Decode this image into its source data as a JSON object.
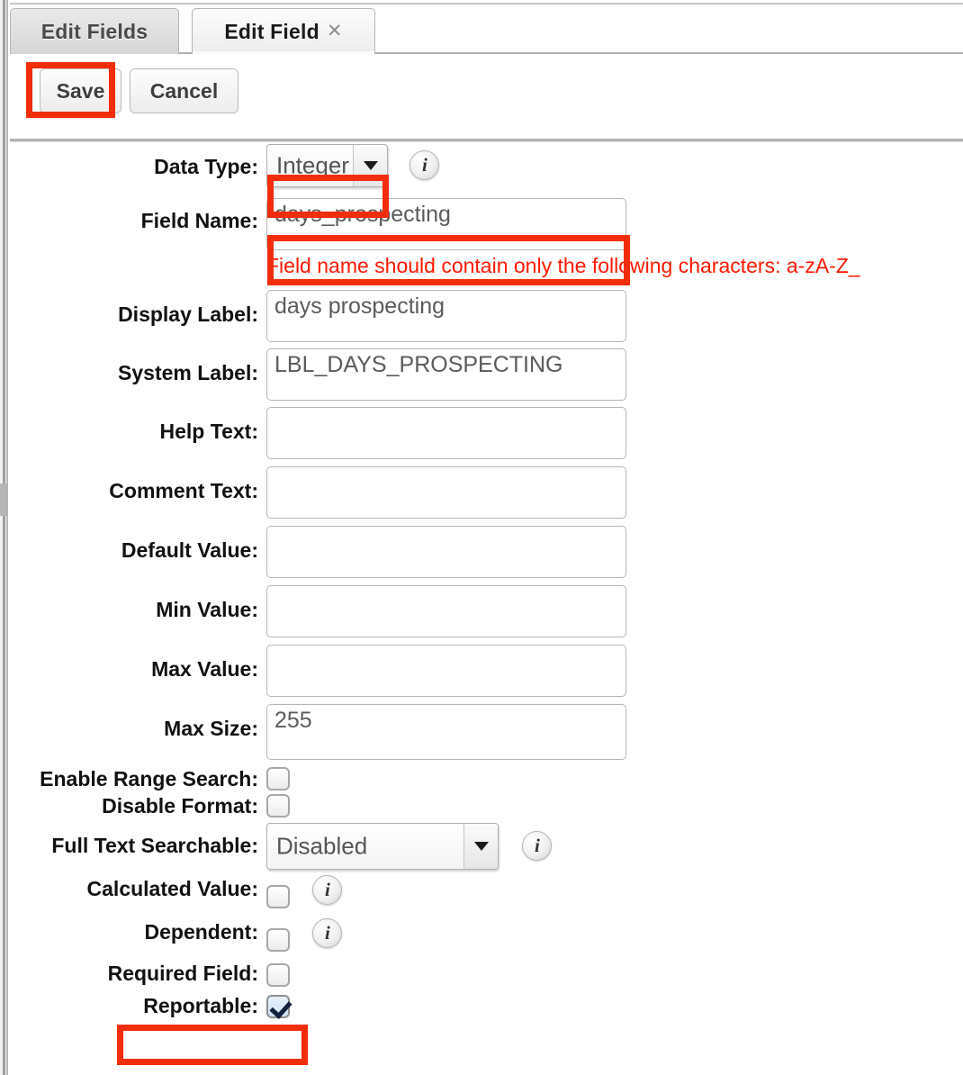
{
  "window": {
    "tabs": [
      {
        "label": "Edit Fields",
        "active": false
      },
      {
        "label": "Edit Field",
        "active": true,
        "close_icon": "close-icon"
      }
    ]
  },
  "toolbar": {
    "save_label": "Save",
    "cancel_label": "Cancel"
  },
  "form": {
    "data_type": {
      "label": "Data Type:",
      "value": "Integer",
      "info_icon": "info-icon",
      "highlighted": true
    },
    "field_name": {
      "label": "Field Name:",
      "value": "days_prospecting",
      "highlighted": true,
      "error": "Field name should contain only the following characters: a-zA-Z_"
    },
    "display_label": {
      "label": "Display Label:",
      "value": "days prospecting"
    },
    "system_label": {
      "label": "System Label:",
      "value": "LBL_DAYS_PROSPECTING"
    },
    "help_text": {
      "label": "Help Text:",
      "value": ""
    },
    "comment_text": {
      "label": "Comment Text:",
      "value": ""
    },
    "default_value": {
      "label": "Default Value:",
      "value": ""
    },
    "min_value": {
      "label": "Min Value:",
      "value": ""
    },
    "max_value": {
      "label": "Max Value:",
      "value": ""
    },
    "max_size": {
      "label": "Max Size:",
      "value": "255"
    },
    "enable_range_search": {
      "label": "Enable Range Search:",
      "checked": false
    },
    "disable_format": {
      "label": "Disable Format:",
      "checked": false
    },
    "full_text_searchable": {
      "label": "Full Text Searchable:",
      "value": "Disabled",
      "info_icon": "info-icon"
    },
    "calculated_value": {
      "label": "Calculated Value:",
      "checked": false,
      "info_icon": "info-icon"
    },
    "dependent": {
      "label": "Dependent:",
      "checked": false,
      "info_icon": "info-icon"
    },
    "required_field": {
      "label": "Required Field:",
      "checked": false
    },
    "reportable": {
      "label": "Reportable:",
      "checked": true,
      "highlighted": true
    }
  },
  "colors": {
    "annotation": "#f22d0c",
    "error_text": "#ff1a00",
    "checkbox_checked_fill": "#cfe4f7"
  }
}
